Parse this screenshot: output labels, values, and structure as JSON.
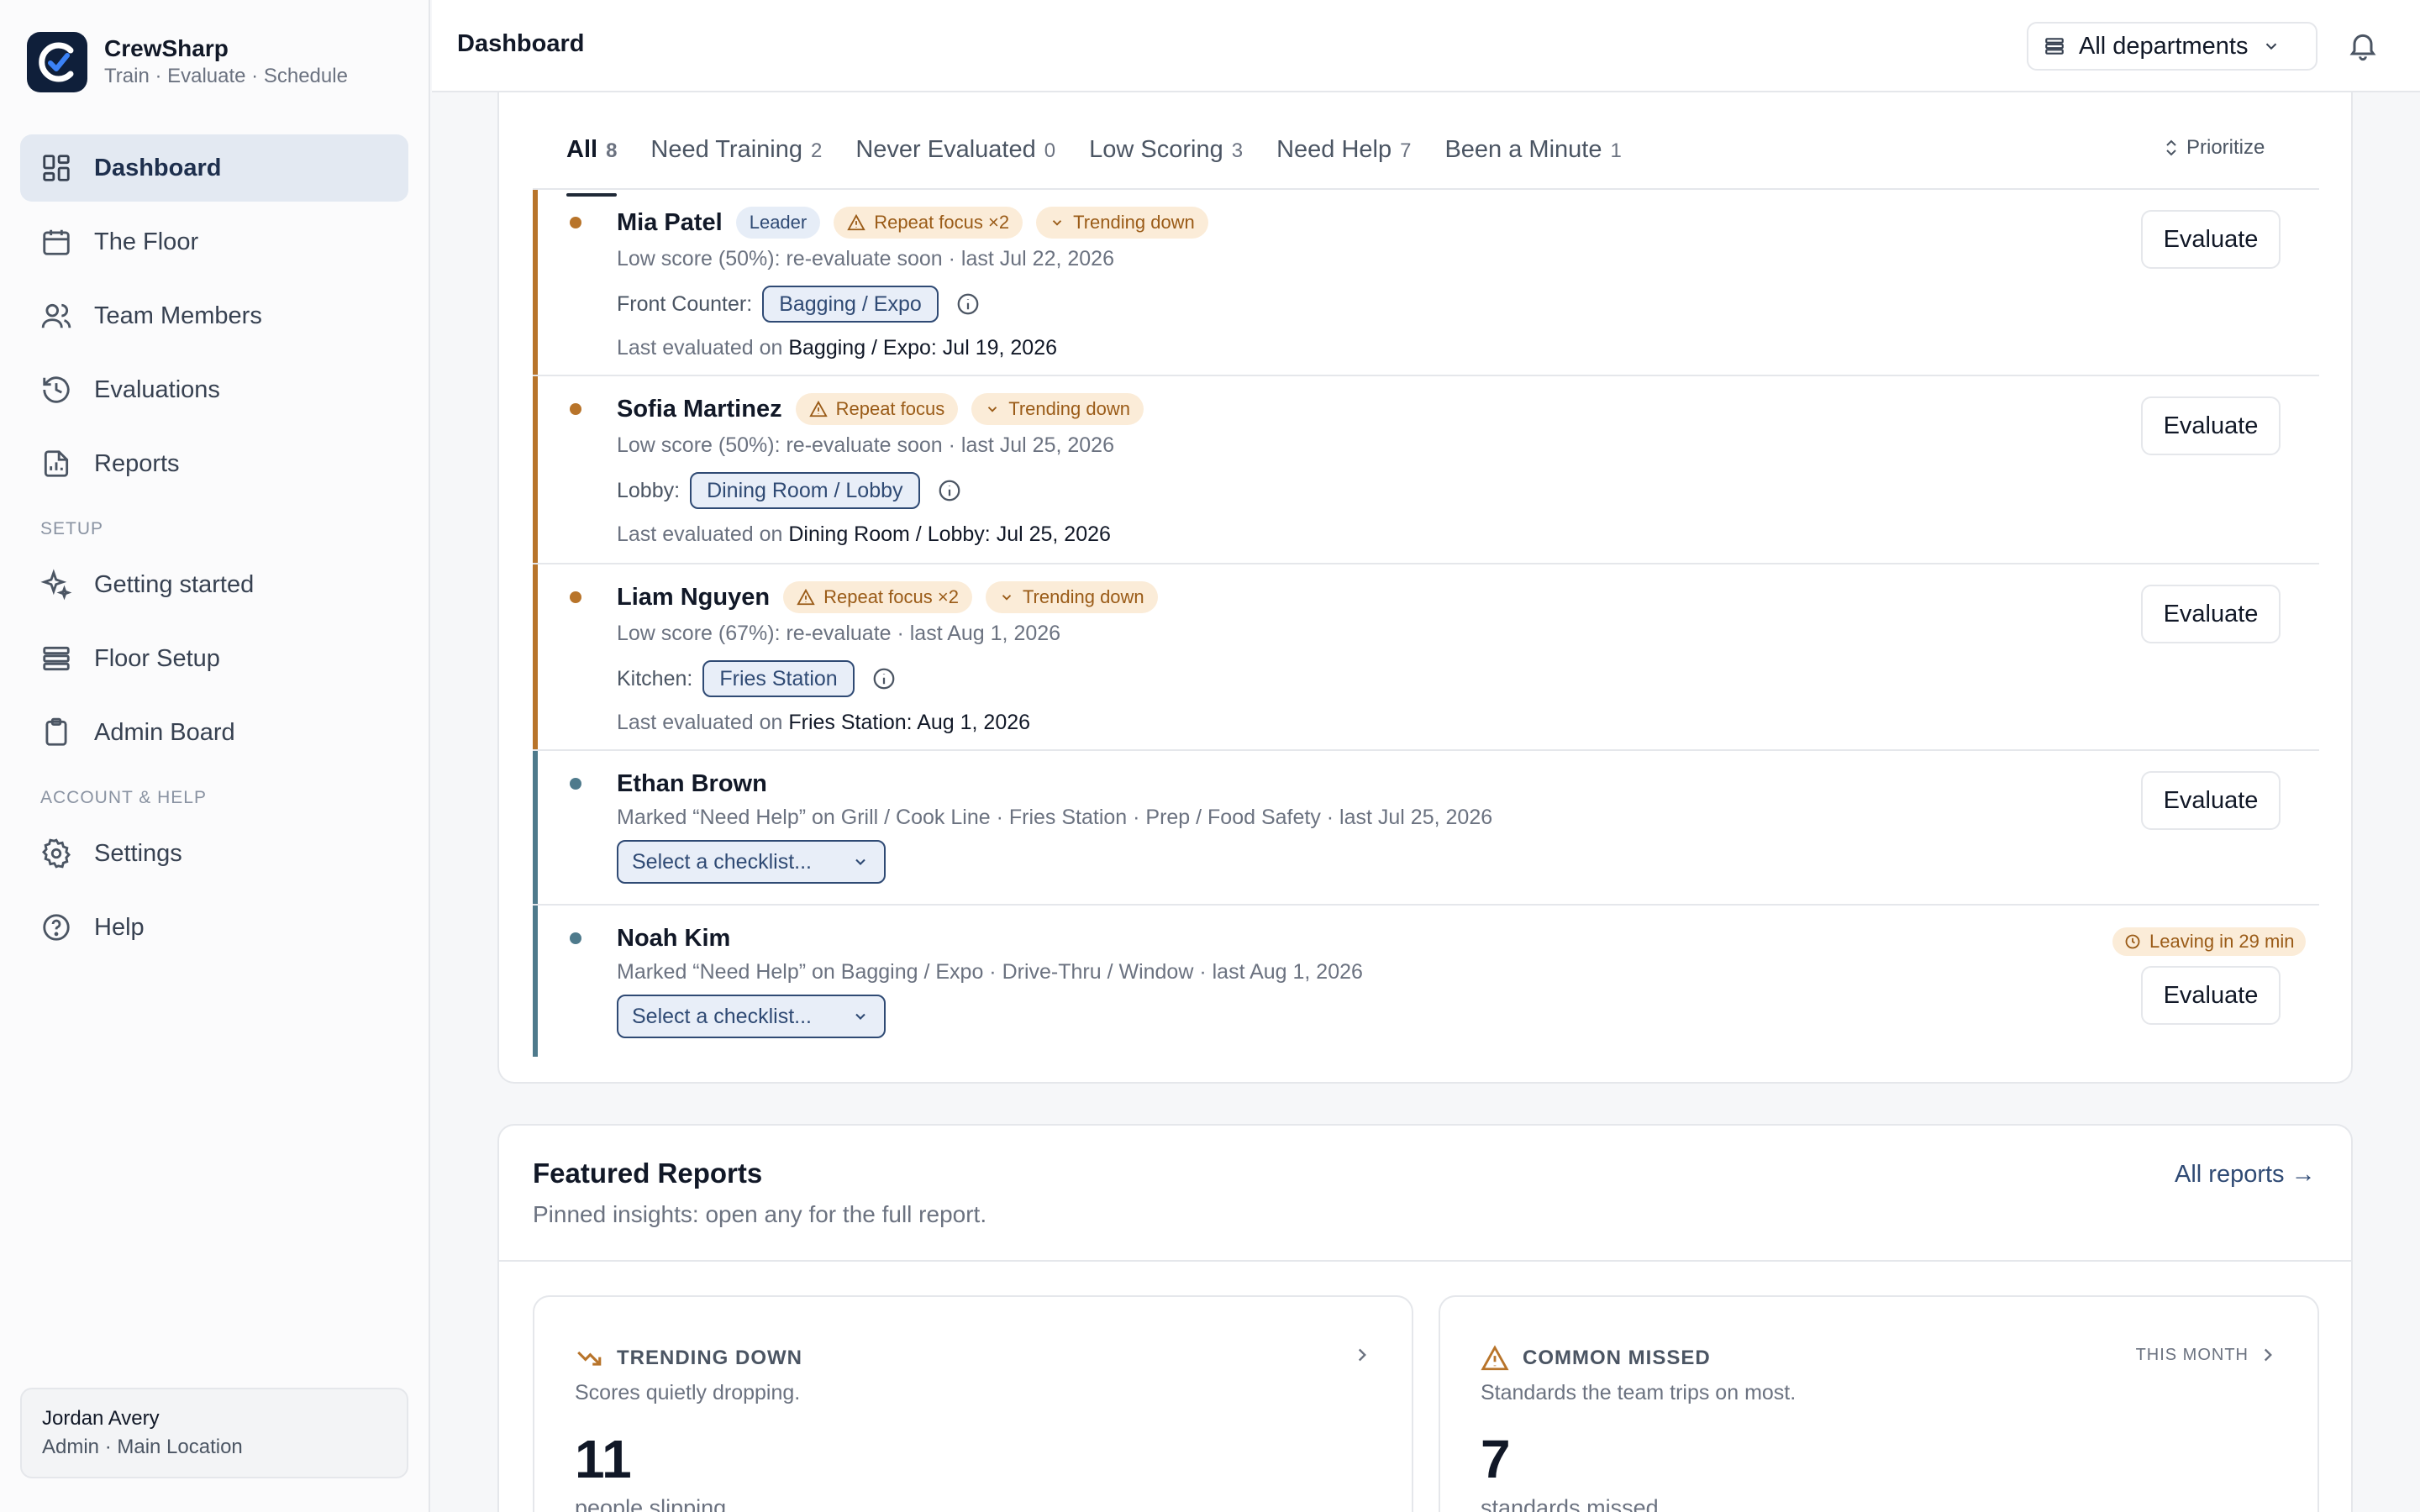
{
  "brand": {
    "name": "CrewSharp",
    "tagline": "Train · Evaluate · Schedule"
  },
  "sidebar": {
    "main_items": [
      {
        "label": "Dashboard",
        "icon": "grid-icon",
        "active": true
      },
      {
        "label": "The Floor",
        "icon": "calendar-icon"
      },
      {
        "label": "Team Members",
        "icon": "users-icon"
      },
      {
        "label": "Evaluations",
        "icon": "history-icon"
      },
      {
        "label": "Reports",
        "icon": "report-icon"
      }
    ],
    "setup_label": "SETUP",
    "setup_items": [
      {
        "label": "Getting started",
        "icon": "sparkles-icon"
      },
      {
        "label": "Floor Setup",
        "icon": "layers-icon"
      },
      {
        "label": "Admin Board",
        "icon": "clipboard-icon"
      }
    ],
    "account_label": "ACCOUNT & HELP",
    "account_items": [
      {
        "label": "Settings",
        "icon": "gear-icon"
      },
      {
        "label": "Help",
        "icon": "help-icon"
      }
    ],
    "user": {
      "name": "Jordan Avery",
      "role": "Admin · Main Location"
    }
  },
  "topbar": {
    "title": "Dashboard",
    "department": "All departments"
  },
  "tabs": [
    {
      "label": "All",
      "count": "8",
      "active": true
    },
    {
      "label": "Need Training",
      "count": "2"
    },
    {
      "label": "Never Evaluated",
      "count": "0"
    },
    {
      "label": "Low Scoring",
      "count": "3"
    },
    {
      "label": "Need Help",
      "count": "7"
    },
    {
      "label": "Been a Minute",
      "count": "1"
    }
  ],
  "prioritize_label": "Prioritize",
  "evaluate_label": "Evaluate",
  "last_evaluated_prefix": "Last evaluated on",
  "checklist_placeholder": "Select a checklist...",
  "colors": {
    "low_score_accent": "#b8742a",
    "need_help_accent": "#4e7a8c"
  },
  "members": [
    {
      "name": "Mia Patel",
      "leader": "Leader",
      "badges": [
        "Repeat focus ×2",
        "Trending down"
      ],
      "sub": "Low score (50%): re-evaluate soon · last Jul 22, 2026",
      "area": "Front Counter:",
      "station": "Bagging / Expo",
      "last_detail": "Bagging / Expo: Jul 19, 2026"
    },
    {
      "name": "Sofia Martinez",
      "badges": [
        "Repeat focus",
        "Trending down"
      ],
      "sub": "Low score (50%): re-evaluate soon · last Jul 25, 2026",
      "area": "Lobby:",
      "station": "Dining Room / Lobby",
      "last_detail": "Dining Room / Lobby: Jul 25, 2026"
    },
    {
      "name": "Liam Nguyen",
      "badges": [
        "Repeat focus ×2",
        "Trending down"
      ],
      "sub": "Low score (67%): re-evaluate · last Aug 1, 2026",
      "area": "Kitchen:",
      "station": "Fries Station",
      "last_detail": "Fries Station: Aug 1, 2026"
    },
    {
      "name": "Ethan Brown",
      "sub": "Marked “Need Help” on Grill / Cook Line · Fries Station · Prep / Food Safety · last Jul 25, 2026"
    },
    {
      "name": "Noah Kim",
      "leaving": "Leaving in 29 min",
      "sub": "Marked “Need Help” on Bagging / Expo · Drive-Thru / Window · last Aug 1, 2026"
    }
  ],
  "reports": {
    "title": "Featured Reports",
    "subtitle": "Pinned insights: open any for the full report.",
    "all_link": "All reports →",
    "cards": [
      {
        "title": "TRENDING DOWN",
        "desc": "Scores quietly dropping.",
        "number": "11",
        "unit": "people slipping"
      },
      {
        "title": "COMMON MISSED",
        "period": "THIS MONTH",
        "desc": "Standards the team trips on most.",
        "number": "7",
        "unit": "standards missed"
      }
    ]
  }
}
